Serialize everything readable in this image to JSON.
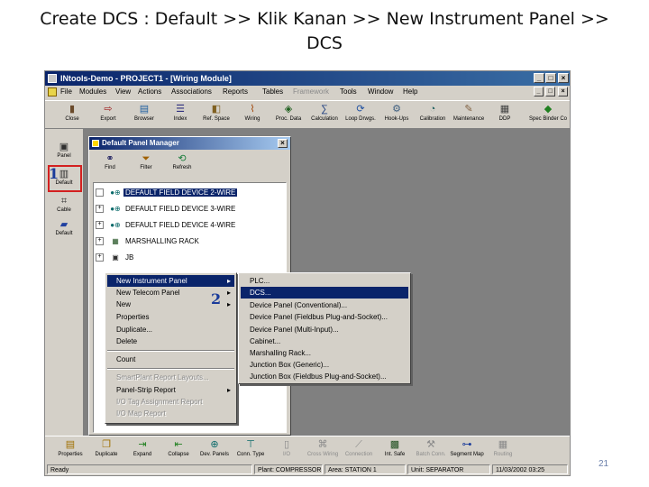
{
  "slide": {
    "title_line1": "Create DCS : Default >> Klik Kanan >> New Instrument Panel >>",
    "title_line2": "DCS",
    "page_number": "21"
  },
  "window": {
    "title": "INtools-Demo - PROJECT1 - [Wiring Module]",
    "controls": [
      "_",
      "□",
      "×"
    ],
    "mdi_controls": [
      "_",
      "□",
      "×"
    ],
    "menu": [
      "File",
      "Modules",
      "View",
      "Actions",
      "Associations",
      "Reports",
      "Tables",
      "Framework",
      "Tools",
      "Window",
      "Help"
    ],
    "menu_disabled_index": 7
  },
  "toolbar": {
    "items": [
      {
        "label": "Close",
        "icon": "close-door-icon"
      },
      {
        "label": "Export",
        "icon": "export-icon"
      },
      {
        "label": "Browser",
        "icon": "browser-icon"
      },
      {
        "label": "Index",
        "icon": "index-icon"
      },
      {
        "label": "Ref. Space",
        "icon": "ref-space-icon"
      },
      {
        "label": "Wiring",
        "icon": "wiring-icon"
      },
      {
        "label": "Proc. Data",
        "icon": "process-data-icon"
      },
      {
        "label": "Calculation",
        "icon": "calculation-icon"
      },
      {
        "label": "Loop Drwgs.",
        "icon": "loop-drawings-icon"
      },
      {
        "label": "Hook-Ups",
        "icon": "hook-ups-icon"
      },
      {
        "label": "Calibration",
        "icon": "calibration-icon"
      },
      {
        "label": "Maintenance",
        "icon": "maintenance-icon"
      },
      {
        "label": "DDP",
        "icon": "ddp-icon"
      },
      {
        "label": "Spec Binder Co",
        "icon": "spec-binder-icon"
      }
    ]
  },
  "sidebar": {
    "items": [
      {
        "label": "Panel",
        "icon": "panel-icon"
      },
      {
        "label": "Default",
        "icon": "default-panel-icon"
      },
      {
        "label": "Cable",
        "icon": "cable-icon"
      },
      {
        "label": "Default",
        "icon": "default-cable-icon"
      }
    ]
  },
  "callouts": {
    "one": "1",
    "two": "2"
  },
  "dialog": {
    "title": "Default Panel Manager",
    "close": "×",
    "toolbar": [
      {
        "label": "Find",
        "icon": "binoculars-icon"
      },
      {
        "label": "Filter",
        "icon": "filter-icon"
      },
      {
        "label": "Refresh",
        "icon": "refresh-icon"
      }
    ],
    "tree": [
      {
        "label": "DEFAULT FIELD DEVICE 2-WIRE",
        "expander": "",
        "selected": true
      },
      {
        "label": "DEFAULT FIELD DEVICE 3-WIRE",
        "expander": "+",
        "selected": false
      },
      {
        "label": "DEFAULT FIELD DEVICE 4-WIRE",
        "expander": "+",
        "selected": false
      },
      {
        "label": "MARSHALLING RACK",
        "expander": "+",
        "selected": false
      },
      {
        "label": "JB",
        "expander": "+",
        "selected": false
      }
    ]
  },
  "context_menu": {
    "items": [
      {
        "label": "New Instrument Panel",
        "submenu": true,
        "highlighted": true,
        "disabled": false
      },
      {
        "label": "New Telecom Panel",
        "submenu": true,
        "highlighted": false,
        "disabled": false
      },
      {
        "label": "New",
        "submenu": true,
        "highlighted": false,
        "disabled": false
      },
      {
        "label": "Properties",
        "submenu": false,
        "highlighted": false,
        "disabled": false
      },
      {
        "label": "Duplicate...",
        "submenu": false,
        "highlighted": false,
        "disabled": false
      },
      {
        "label": "Delete",
        "submenu": false,
        "highlighted": false,
        "disabled": false
      },
      {
        "label": "Count",
        "submenu": false,
        "highlighted": false,
        "disabled": false
      },
      {
        "label": "SmartPlant Report Layouts...",
        "submenu": false,
        "highlighted": false,
        "disabled": true
      },
      {
        "label": "Panel-Strip Report",
        "submenu": true,
        "highlighted": false,
        "disabled": false
      },
      {
        "label": "I/O Tag Assignment Report",
        "submenu": false,
        "highlighted": false,
        "disabled": true
      },
      {
        "label": "I/O Map Report",
        "submenu": false,
        "highlighted": false,
        "disabled": true
      }
    ]
  },
  "submenu": {
    "items": [
      {
        "label": "PLC...",
        "highlighted": false
      },
      {
        "label": "DCS...",
        "highlighted": true
      },
      {
        "label": "Device Panel (Conventional)...",
        "highlighted": false
      },
      {
        "label": "Device Panel (Fieldbus Plug-and-Socket)...",
        "highlighted": false
      },
      {
        "label": "Device Panel (Multi-Input)...",
        "highlighted": false
      },
      {
        "label": "Cabinet...",
        "highlighted": false
      },
      {
        "label": "Marshalling Rack...",
        "highlighted": false
      },
      {
        "label": "Junction Box (Generic)...",
        "highlighted": false
      },
      {
        "label": "Junction Box (Fieldbus Plug-and-Socket)...",
        "highlighted": false
      }
    ]
  },
  "bottom_toolbar": {
    "items": [
      {
        "label": "Properties",
        "icon": "properties-icon",
        "disabled": false
      },
      {
        "label": "Duplicate",
        "icon": "duplicate-icon",
        "disabled": false
      },
      {
        "label": "Expand",
        "icon": "expand-icon",
        "disabled": false
      },
      {
        "label": "Collapse",
        "icon": "collapse-icon",
        "disabled": false
      },
      {
        "label": "Dev. Panels",
        "icon": "device-panels-icon",
        "disabled": false
      },
      {
        "label": "Conn. Type",
        "icon": "connection-type-icon",
        "disabled": false
      },
      {
        "label": "I/O",
        "icon": "io-icon",
        "disabled": true
      },
      {
        "label": "Cross Wiring",
        "icon": "cross-wiring-icon",
        "disabled": true
      },
      {
        "label": "Connection",
        "icon": "connection-icon",
        "disabled": true
      },
      {
        "label": "Int. Safe",
        "icon": "intrinsic-safe-icon",
        "disabled": false
      },
      {
        "label": "Batch Conn.",
        "icon": "batch-connection-icon",
        "disabled": true
      },
      {
        "label": "Segment Map",
        "icon": "segment-map-icon",
        "disabled": false
      },
      {
        "label": "Routing",
        "icon": "routing-icon",
        "disabled": true
      }
    ]
  },
  "statusbar": {
    "ready": "Ready",
    "plant": "Plant: COMPRESSOR",
    "area": "Area: STATION 1",
    "unit": "Unit: SEPARATOR",
    "datetime": "11/03/2002 03:25"
  }
}
